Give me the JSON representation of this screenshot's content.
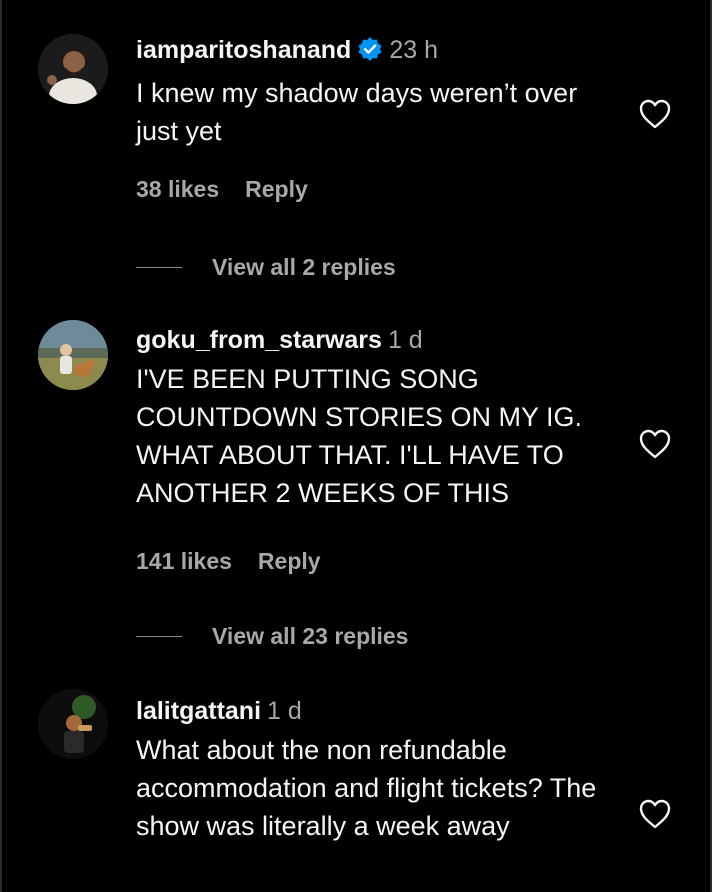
{
  "comments": [
    {
      "username": "iamparitoshanand",
      "verified": true,
      "time": "23 h",
      "text": "I knew my shadow days weren’t over just yet",
      "likes": "38 likes",
      "reply": "Reply",
      "view_replies": "View all 2 replies"
    },
    {
      "username": "goku_from_starwars",
      "verified": false,
      "time": "1 d",
      "text": "I'VE BEEN PUTTING SONG COUNTDOWN STORIES ON MY IG. WHAT ABOUT THAT. I'LL HAVE TO ANOTHER 2 WEEKS OF THIS",
      "likes": "141 likes",
      "reply": "Reply",
      "view_replies": "View all 23 replies"
    },
    {
      "username": "lalitgattani",
      "verified": false,
      "time": "1 d",
      "text": "What about the non refundable accommodation and flight tickets? The show was literally a week away",
      "likes": "",
      "reply": "",
      "view_replies": ""
    }
  ],
  "icons": {
    "heart": "heart-outline-icon",
    "verified": "verified-badge-icon"
  },
  "colors": {
    "background": "#000000",
    "text_primary": "#f5f5f5",
    "text_secondary": "#a8a8a8",
    "verified_blue": "#0095f6"
  }
}
